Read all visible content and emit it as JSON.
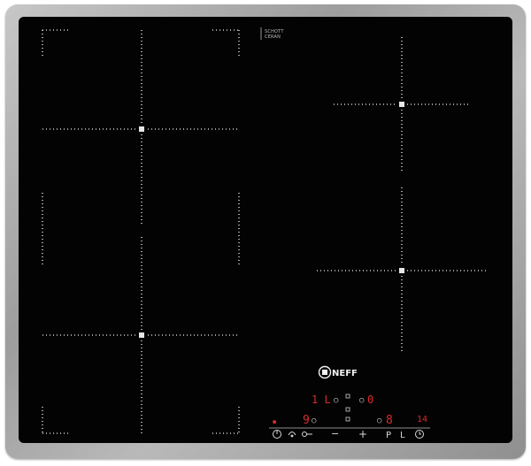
{
  "brand": {
    "logo": "NEFF",
    "glass_maker_top": "SCHOTT",
    "glass_maker_bottom": "CERAN"
  },
  "display": {
    "row1_left": "1 L",
    "row1_right": "0",
    "row2_left": "9",
    "row2_mid": "8",
    "row2_right": "14"
  },
  "controls": {
    "minus": "−",
    "plus": "+",
    "p": "P",
    "l": "L"
  },
  "colors": {
    "glass": "#030303",
    "frame": "#a9a9a9",
    "markings": "#cfcfcf",
    "display": "#d82a2a"
  }
}
